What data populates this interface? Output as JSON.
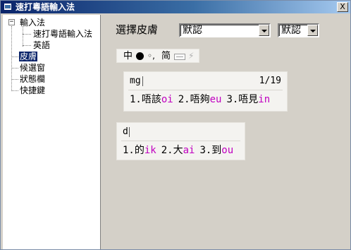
{
  "window": {
    "title": "速打粵語輸入法",
    "close_label": "X"
  },
  "tree": {
    "items": [
      {
        "label": "輸入法"
      },
      {
        "label": "速打粵語輸入法"
      },
      {
        "label": "英語"
      },
      {
        "label": "皮膚",
        "selected": true
      },
      {
        "label": "候選窗"
      },
      {
        "label": "狀態欄"
      },
      {
        "label": "快捷鍵"
      }
    ]
  },
  "skin": {
    "label": "選擇皮膚",
    "skin_select": "默認",
    "variant_select": "默認"
  },
  "statusbar": {
    "zh": "中",
    "half": "◦,",
    "trad": "简",
    "bolt": "⚡"
  },
  "preview1": {
    "composition": "mg",
    "page": "1/19",
    "candidates": [
      {
        "num": "1.",
        "ch": "唔該",
        "code": "oi"
      },
      {
        "num": "2.",
        "ch": "唔夠",
        "code": "eu"
      },
      {
        "num": "3.",
        "ch": "唔見",
        "code": "in"
      }
    ]
  },
  "preview2": {
    "composition": "d",
    "candidates": [
      {
        "num": "1.",
        "ch": "的",
        "code": "ik"
      },
      {
        "num": "2.",
        "ch": "大",
        "code": "ai"
      },
      {
        "num": "3.",
        "ch": "到",
        "code": "ou"
      }
    ]
  }
}
